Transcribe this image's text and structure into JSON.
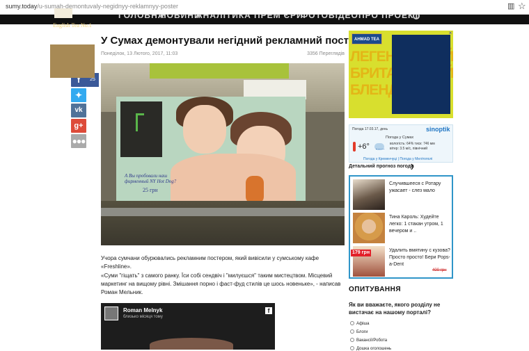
{
  "browser": {
    "url_domain": "sumy.today",
    "url_path": "/u-sumah-demontuvaly-negidnyy-reklamnyy-poster"
  },
  "nav": {
    "items": [
      "ГОЛОВНА",
      "НОВИНИ",
      "АНАЛІТИКА",
      "ПРЕМ'ЄРИ",
      "ФОТО",
      "ВІДЕО",
      "ПРО ПРОЕКТ"
    ]
  },
  "article": {
    "title": "У Сумах демонтували негідний рекламний постер",
    "date": "Понеділок, 13 Лютого, 2017, 11:03",
    "views": "3356 Переглядів",
    "photo_text": "А Вы пробовали наш фирменный NY Hot Dog?",
    "photo_price": "25 грн",
    "paragraph_1": "Учора сумчани обурювались рекламним постером, який вивісили у сумському кафе «Freshline».",
    "paragraph_2": "«Суми \"гіщать\" з самого ранку. Їси собі сендвіч і \"милуєшся\" таким мистецтвом. Місцевий маркетинг на вищому рівні. Змішання порно і фаст-фуд стилів це шось новеньке», - написав Роман Мельник."
  },
  "share": {
    "facebook_count": "25"
  },
  "embed": {
    "author": "Roman Melnyk",
    "time": "близько місяця тому"
  },
  "ad": {
    "brand": "AHMAD TEA",
    "headline": "ЛЕГЕНДАРНИЙ БРИТАНСЬКИЙ БЛЕНД",
    "product": "English Tea No.1"
  },
  "weather": {
    "date": "Погода 17.03.17, день",
    "logo": "sinoptik",
    "city": "Погода у Сумах",
    "temp": "+6°",
    "humidity": "вологість: 64%",
    "pressure": "тиск: 746 мм",
    "wind": "вітер: 3.5 м/с, північний",
    "links": "Погода у Кременчуці | Погода у Мелітополі",
    "forecast_link": "Детальний прогноз погоди"
  },
  "teasers": [
    {
      "text": "Случившееся с Ротару ужасает - слез мало"
    },
    {
      "text": "Тина Кароль: Худейте легко: 1 стакан утром, 1 вечером и .."
    },
    {
      "text": "Удалить вмятину с кузова? Просто просто! Бери Pops-a-Dent",
      "price": "179 грн",
      "old_price": "400 грн"
    }
  ],
  "poll": {
    "title": "ОПИТУВАННЯ",
    "question": "Як ви вважаєте, якого розділу не вистачає на нашому порталі?",
    "options": [
      "Афіша",
      "Блоги",
      "Вакансії/Робота",
      "Дошка оголошень"
    ]
  }
}
